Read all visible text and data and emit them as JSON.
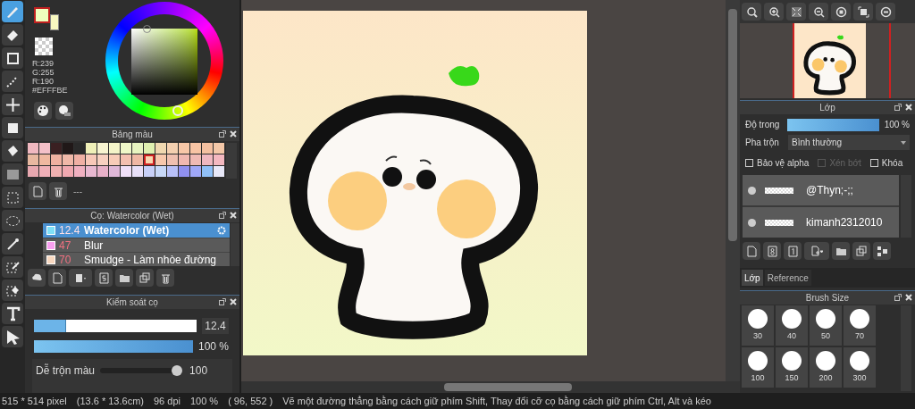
{
  "tools": [
    {
      "kind": "brush",
      "selected": true
    },
    {
      "kind": "eraser",
      "selected": false
    },
    {
      "kind": "rect",
      "selected": false
    },
    {
      "kind": "dotline",
      "selected": false
    },
    {
      "kind": "move",
      "selected": false
    },
    {
      "kind": "fillrect",
      "selected": false
    },
    {
      "kind": "bucket",
      "selected": false
    },
    {
      "kind": "gradient",
      "selected": false
    },
    {
      "kind": "selrect",
      "selected": false
    },
    {
      "kind": "lasso",
      "selected": false
    },
    {
      "kind": "wand",
      "selected": false
    },
    {
      "kind": "selpen",
      "selected": false
    },
    {
      "kind": "selerase",
      "selected": false
    },
    {
      "kind": "text",
      "selected": false
    },
    {
      "kind": "operate",
      "selected": false
    }
  ],
  "color_panel": {
    "rgb": [
      "R:239",
      "G:255",
      "R:190"
    ],
    "hex": "#EFFFBE"
  },
  "palette": {
    "title": "Bảng màu",
    "label": "---",
    "swatches": [
      {
        "color": "#f0b8c0",
        "selected": false
      },
      {
        "color": "#f4c0c8",
        "selected": false
      },
      {
        "color": "#3a2022",
        "selected": false
      },
      {
        "color": "#201818",
        "selected": false
      },
      {
        "color": "#2a2a2a",
        "selected": false
      },
      {
        "color": "#f0f0b8",
        "selected": false
      },
      {
        "color": "#f8f4d0",
        "selected": false
      },
      {
        "color": "#f4f4c8",
        "selected": false
      },
      {
        "color": "#f0f8c8",
        "selected": false
      },
      {
        "color": "#e8f4c0",
        "selected": false
      },
      {
        "color": "#e0f0b0",
        "selected": false
      },
      {
        "color": "#f0d8b0",
        "selected": false
      },
      {
        "color": "#f4d0b0",
        "selected": false
      },
      {
        "color": "#f8c8a8",
        "selected": false
      },
      {
        "color": "#f8c4a4",
        "selected": false
      },
      {
        "color": "#f4c0a0",
        "selected": false
      },
      {
        "color": "#f4c8a8",
        "selected": false
      },
      {
        "color": "#e8b8a0",
        "selected": false
      },
      {
        "color": "#f0b8a0",
        "selected": false
      },
      {
        "color": "#f0b0a0",
        "selected": false
      },
      {
        "color": "#f0b8a8",
        "selected": false
      },
      {
        "color": "#f0b0a4",
        "selected": false
      },
      {
        "color": "#f8c8b8",
        "selected": false
      },
      {
        "color": "#f8d0c0",
        "selected": false
      },
      {
        "color": "#f8ccb8",
        "selected": false
      },
      {
        "color": "#f4c0b0",
        "selected": false
      },
      {
        "color": "#f0b8a4",
        "selected": false
      },
      {
        "color": "#f8d8b0",
        "selected": true
      },
      {
        "color": "#f8c8ac",
        "selected": false
      },
      {
        "color": "#f0c0b0",
        "selected": false
      },
      {
        "color": "#f0b8b0",
        "selected": false
      },
      {
        "color": "#f0bab4",
        "selected": false
      },
      {
        "color": "#f0b8c0",
        "selected": false
      },
      {
        "color": "#f4b8c0",
        "selected": false
      },
      {
        "color": "#e8a8b0",
        "selected": false
      },
      {
        "color": "#f0b0b8",
        "selected": false
      },
      {
        "color": "#f0b0b0",
        "selected": false
      },
      {
        "color": "#f0a8b0",
        "selected": false
      },
      {
        "color": "#f0b0c0",
        "selected": false
      },
      {
        "color": "#e8b8d0",
        "selected": false
      },
      {
        "color": "#e8b0c8",
        "selected": false
      },
      {
        "color": "#e0b8d8",
        "selected": false
      },
      {
        "color": "#f0e0f8",
        "selected": false
      },
      {
        "color": "#e8e0f8",
        "selected": false
      },
      {
        "color": "#c8d0f8",
        "selected": false
      },
      {
        "color": "#c8d8f8",
        "selected": false
      },
      {
        "color": "#b8c0f8",
        "selected": false
      },
      {
        "color": "#9090f0",
        "selected": false
      },
      {
        "color": "#a0a8f8",
        "selected": false
      },
      {
        "color": "#90c0f8",
        "selected": false
      },
      {
        "color": "#e8e8f8",
        "selected": false
      }
    ]
  },
  "brush_panel": {
    "title": "Cọ: Watercolor (Wet)",
    "brushes": [
      {
        "color": "#80e0f8",
        "size": "12.4",
        "name": "Watercolor (Wet)",
        "selected": true
      },
      {
        "color": "#f8a0f0",
        "size": "47",
        "name": "Blur",
        "selected": false
      },
      {
        "color": "#f8d8c0",
        "size": "70",
        "name": "Smudge - Làm nhòe đường",
        "selected": false
      }
    ]
  },
  "brush_control": {
    "title": "Kiểm soát cọ",
    "size": {
      "level": 0.2,
      "value": "12.4"
    },
    "opacity": {
      "level": 1,
      "reading": "100 %"
    },
    "sliders": [
      {
        "label": "Dễ trộn màu",
        "level": 1,
        "reading": "100"
      }
    ]
  },
  "layer_panel": {
    "title": "Lớp",
    "opacity_label": "Độ trong",
    "opacity": {
      "level": 1,
      "reading": "100 %"
    },
    "blend_label": "Pha trộn",
    "blend_value": "Bình thường",
    "options": [
      {
        "label": "Bảo vệ alpha",
        "checked": false,
        "disabled": false
      },
      {
        "label": "Xén bớt",
        "checked": false,
        "disabled": true
      },
      {
        "label": "Khóa",
        "checked": false,
        "disabled": false
      }
    ],
    "layers": [
      {
        "name": "@Thyn;-;;",
        "visible": true
      },
      {
        "name": "kimanh2312010",
        "visible": true
      }
    ]
  },
  "right_tabs": [
    {
      "label": "Lớp",
      "selected": true
    },
    {
      "label": "Reference",
      "selected": false
    }
  ],
  "brush_size": {
    "title": "Brush Size",
    "sizes": [
      "30",
      "40",
      "50",
      "70",
      "100",
      "150",
      "200",
      "300"
    ]
  },
  "status_bar": "515 * 514 pixel　(13.6 * 13.6cm)　96 dpi　100 %　( 96, 552 )　Vẽ một đường thẳng bằng cách giữ phím Shift, Thay đổi cỡ cọ bằng cách giữ phím Ctrl, Alt và kéo"
}
